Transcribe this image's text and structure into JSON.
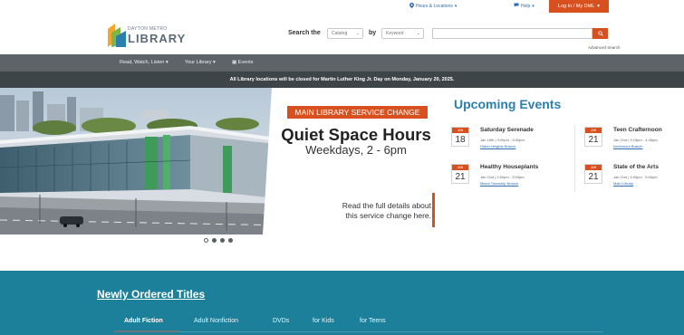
{
  "utility": {
    "hours_label": "Hours & Locations",
    "help_label": "Help",
    "login_label": "Log In / My DML"
  },
  "header": {
    "logo_small": "DAYTON METRO",
    "logo_big": "LIBRARY",
    "search_label": "Search the",
    "catalog_select": "Catalog",
    "by_label": "by",
    "keyword_select": "Keyword",
    "search_placeholder": "",
    "advanced_search": "Advanced Search"
  },
  "nav": {
    "items": [
      {
        "label": "Read, Watch, Listen"
      },
      {
        "label": "Your Library"
      },
      {
        "label": "Events"
      }
    ]
  },
  "alert": {
    "text": "All Library locations will be closed for Martin Luther King Jr. Day on Monday, January 20, 2025."
  },
  "promo": {
    "banner": "MAIN LIBRARY SERVICE CHANGE",
    "title": "Quiet Space Hours",
    "subtitle": "Weekdays, 2 - 6pm",
    "note_line1": "Read the full details about",
    "note_line2": "this service change here."
  },
  "events": {
    "title": "Upcoming Events",
    "items": [
      {
        "month": "JAN",
        "day": "18",
        "name": "Saturday Serenade",
        "time": "Jan 18th | 3:00pm - 5:00pm",
        "location": "Huber Heights Branch"
      },
      {
        "month": "JAN",
        "day": "21",
        "name": "Healthy Houseplants",
        "time": "Jan 21st | 2:00pm - 3:00pm",
        "location": "Miami Township Branch"
      },
      {
        "month": "JAN",
        "day": "21",
        "name": "Teen Crafternoon",
        "time": "Jan 21st | 3:15pm - 4:45pm",
        "location": "Northmont Branch"
      },
      {
        "month": "JAN",
        "day": "21",
        "name": "State of the Arts",
        "time": "Jan 21st | 4:00pm - 5:00pm",
        "location": "Main Library"
      }
    ]
  },
  "carousel": {
    "slide_count": 4,
    "active_index": 0
  },
  "titles": {
    "heading": "Newly Ordered Titles",
    "tabs": [
      {
        "label": "Adult Fiction"
      },
      {
        "label": "Adult Nonfiction"
      },
      {
        "label": "DVDs"
      },
      {
        "label": "for Kids"
      },
      {
        "label": "for Teens"
      }
    ]
  },
  "colors": {
    "accent": "#d9501f",
    "link": "#2f6db3",
    "events_title": "#2a7fae",
    "nav_bg": "#5d6367",
    "alert_bg": "#3e4549",
    "titles_bg": "#1d809b"
  },
  "icons": {
    "hours": "map-pin-icon",
    "help": "chat-icon",
    "search": "search-icon",
    "events": "calendar-icon"
  }
}
